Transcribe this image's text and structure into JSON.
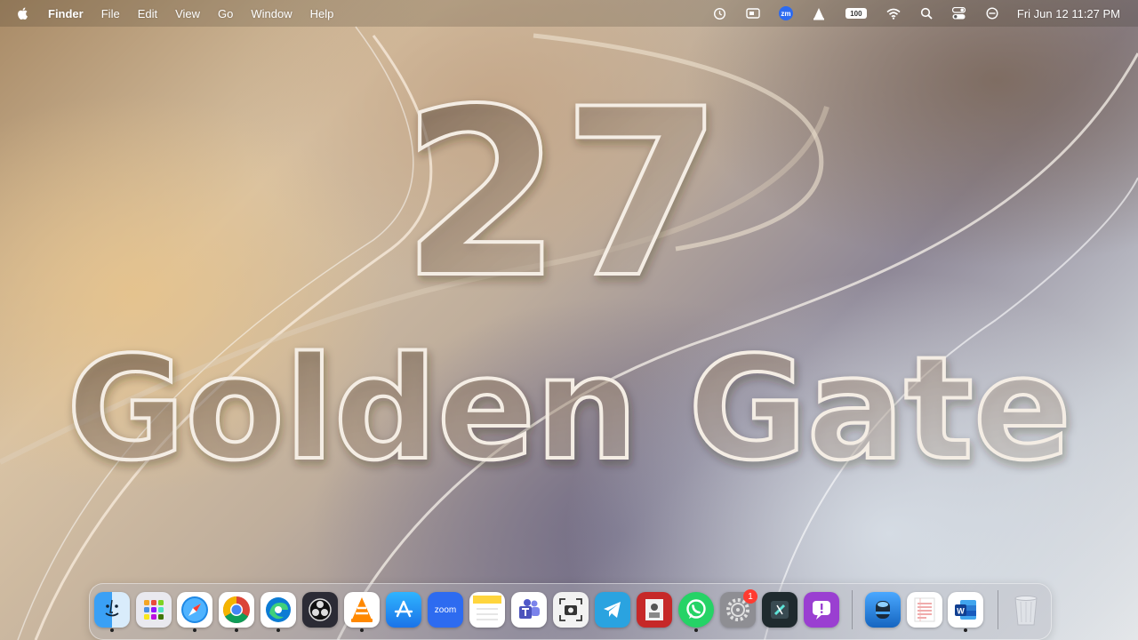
{
  "menubar": {
    "app_name": "Finder",
    "menus": [
      "File",
      "Edit",
      "View",
      "Go",
      "Window",
      "Help"
    ],
    "status_icons": [
      "time-machine-icon",
      "screen-icon",
      "zoom-status-icon",
      "vlc-status-icon",
      "battery-icon",
      "wifi-icon",
      "spotlight-search-icon",
      "control-center-icon",
      "focus-icon"
    ],
    "zoom_label": "zm",
    "battery_label": "100",
    "clock": "Fri Jun 12  11:27 PM"
  },
  "wallpaper": {
    "number": "27",
    "title": "Golden Gate"
  },
  "dock": {
    "apps": [
      {
        "name": "Finder",
        "icon": "finder-icon",
        "running": true
      },
      {
        "name": "Launchpad",
        "icon": "launchpad-icon",
        "running": false
      },
      {
        "name": "Safari",
        "icon": "safari-icon",
        "running": true
      },
      {
        "name": "Chrome",
        "icon": "chrome-icon",
        "running": true
      },
      {
        "name": "Edge",
        "icon": "edge-icon",
        "running": true
      },
      {
        "name": "OBS",
        "icon": "obs-icon",
        "running": false
      },
      {
        "name": "VLC",
        "icon": "vlc-icon",
        "running": true
      },
      {
        "name": "App Store",
        "icon": "app-store-icon",
        "running": false
      },
      {
        "name": "Zoom",
        "icon": "zoom-icon",
        "label": "zoom",
        "running": false
      },
      {
        "name": "Notes",
        "icon": "notes-icon",
        "running": false
      },
      {
        "name": "Teams",
        "icon": "teams-icon",
        "running": false
      },
      {
        "name": "Screenshot",
        "icon": "screenshot-icon",
        "running": false
      },
      {
        "name": "Telegram",
        "icon": "telegram-icon",
        "running": false
      },
      {
        "name": "Photo Booth",
        "icon": "photo-booth-icon",
        "running": false
      },
      {
        "name": "WhatsApp",
        "icon": "whatsapp-icon",
        "running": true
      },
      {
        "name": "System Settings",
        "icon": "system-settings-icon",
        "running": false,
        "badge": "1"
      },
      {
        "name": "Final Cut",
        "icon": "final-cut-icon",
        "running": false
      },
      {
        "name": "Feedback",
        "icon": "feedback-icon",
        "running": false
      },
      {
        "name": "Utility",
        "icon": "utility-icon",
        "running": false
      },
      {
        "name": "TextEdit",
        "icon": "textedit-icon",
        "running": false
      },
      {
        "name": "Word",
        "icon": "word-icon",
        "running": true
      },
      {
        "name": "Trash",
        "icon": "trash-icon",
        "running": false
      }
    ]
  },
  "colors": {
    "zoom_blue": "#2d6bf0",
    "badge_red": "#ff3b30",
    "whatsapp_green": "#25d366",
    "telegram_blue": "#2aa3e0"
  }
}
